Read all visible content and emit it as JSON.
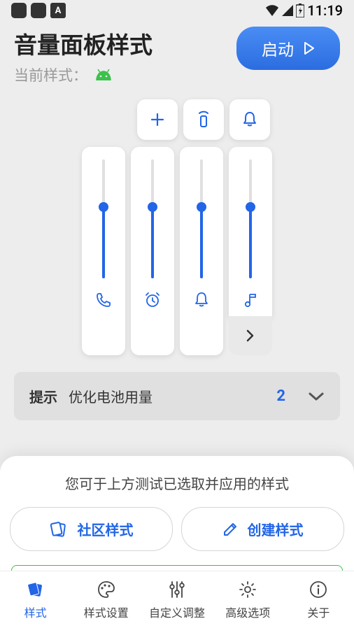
{
  "status": {
    "time": "11:19"
  },
  "header": {
    "title": "音量面板样式",
    "subtitle": "当前样式：",
    "launch": "启动"
  },
  "sliders": [
    {
      "icon": "phone",
      "level": 0.6
    },
    {
      "icon": "alarm",
      "level": 0.6
    },
    {
      "icon": "bell",
      "level": 0.6
    },
    {
      "icon": "music",
      "level": 0.6
    }
  ],
  "tip": {
    "label": "提示",
    "text": "优化电池用量",
    "count": "2"
  },
  "sheet": {
    "text": "您可于上方测试已选取并应用的样式",
    "community": "社区样式",
    "create": "创建样式"
  },
  "nav": {
    "style": "样式",
    "style_settings": "样式设置",
    "custom": "自定义调整",
    "advanced": "高级选项",
    "about": "关于"
  }
}
